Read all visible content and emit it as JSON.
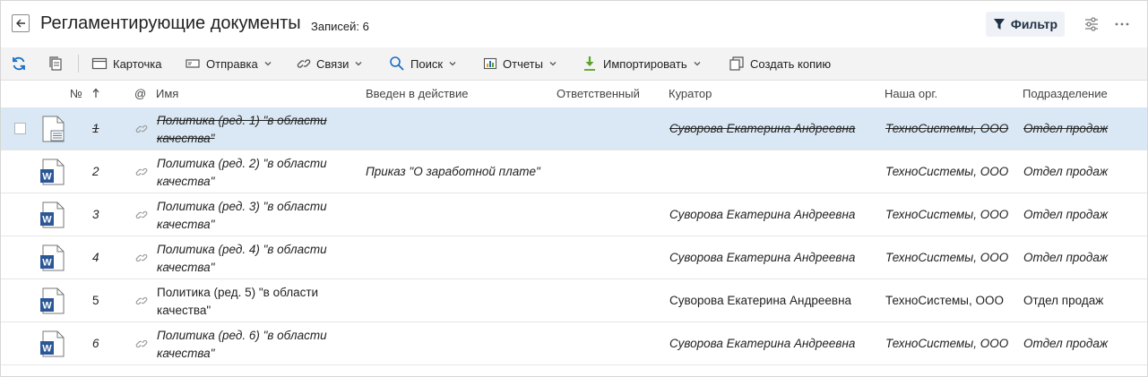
{
  "header": {
    "title": "Регламентирующие документы",
    "count": "Записей: 6",
    "filter_label": "Фильтр"
  },
  "toolbar": {
    "card": "Карточка",
    "send": "Отправка",
    "links": "Связи",
    "search": "Поиск",
    "reports": "Отчеты",
    "import": "Импортировать",
    "copy": "Создать копию"
  },
  "columns": {
    "num": "№",
    "at": "@",
    "name": "Имя",
    "effective": "Введен в действие",
    "responsible": "Ответственный",
    "curator": "Куратор",
    "org": "Наша орг.",
    "department": "Подразделение"
  },
  "rows": [
    {
      "num": "1",
      "name_line1": "Политика (ред. 1) \"в области",
      "name_line2": "качества\"",
      "effective": "",
      "responsible": "",
      "curator": "Суворова Екатерина Андреевна",
      "org": "ТехноСистемы, ООО",
      "department": "Отдел продаж",
      "style": "strike",
      "selected": true,
      "icon": "generic-doc-icon"
    },
    {
      "num": "2",
      "name_line1": "Политика (ред. 2) \"в области",
      "name_line2": "качества\"",
      "effective": "Приказ \"О заработной плате\"",
      "responsible": "",
      "curator": "",
      "org": "ТехноСистемы, ООО",
      "department": "Отдел продаж",
      "style": "italic",
      "selected": false,
      "icon": "word-doc-icon"
    },
    {
      "num": "3",
      "name_line1": "Политика (ред. 3) \"в области",
      "name_line2": "качества\"",
      "effective": "",
      "responsible": "",
      "curator": "Суворова Екатерина Андреевна",
      "org": "ТехноСистемы, ООО",
      "department": "Отдел продаж",
      "style": "italic",
      "selected": false,
      "icon": "word-doc-icon"
    },
    {
      "num": "4",
      "name_line1": "Политика (ред. 4) \"в области",
      "name_line2": "качества\"",
      "effective": "",
      "responsible": "",
      "curator": "Суворова Екатерина Андреевна",
      "org": "ТехноСистемы, ООО",
      "department": "Отдел продаж",
      "style": "italic",
      "selected": false,
      "icon": "word-doc-icon"
    },
    {
      "num": "5",
      "name_line1": "Политика (ред. 5) \"в области",
      "name_line2": "качества\"",
      "effective": "",
      "responsible": "",
      "curator": "Суворова Екатерина Андреевна",
      "org": "ТехноСистемы, ООО",
      "department": "Отдел продаж",
      "style": "normal",
      "selected": false,
      "icon": "word-doc-icon"
    },
    {
      "num": "6",
      "name_line1": "Политика (ред. 6) \"в области",
      "name_line2": "качества\"",
      "effective": "",
      "responsible": "",
      "curator": "Суворова Екатерина Андреевна",
      "org": "ТехноСистемы, ООО",
      "department": "Отдел продаж",
      "style": "italic",
      "selected": false,
      "icon": "word-doc-icon"
    }
  ],
  "colors": {
    "selected_row": "#d9e8f4",
    "toolbar_bg": "#f3f3f3",
    "word_blue": "#2b5797",
    "refresh_blue": "#1a6fc4",
    "import_green": "#5aa32a"
  }
}
